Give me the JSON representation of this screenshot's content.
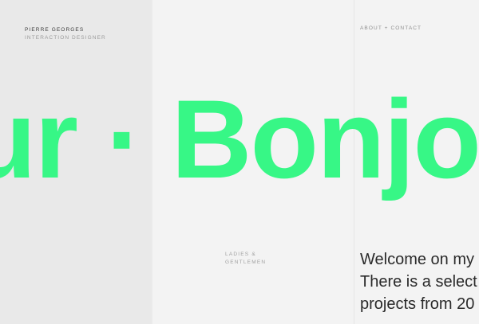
{
  "brand": {
    "name": "PIERRE GEORGES",
    "role": "INTERACTION DESIGNER"
  },
  "nav": {
    "about_contact": "ABOUT + CONTACT"
  },
  "hero": {
    "marquee_text": "ur · Bonjour",
    "accent_color": "#37f786"
  },
  "intro": {
    "label_line1": "LADIES &",
    "label_line2": "GENTLEMEN",
    "welcome_line1": "Welcome on my",
    "welcome_line2": "There is a select",
    "welcome_line3": "projects from 20"
  }
}
